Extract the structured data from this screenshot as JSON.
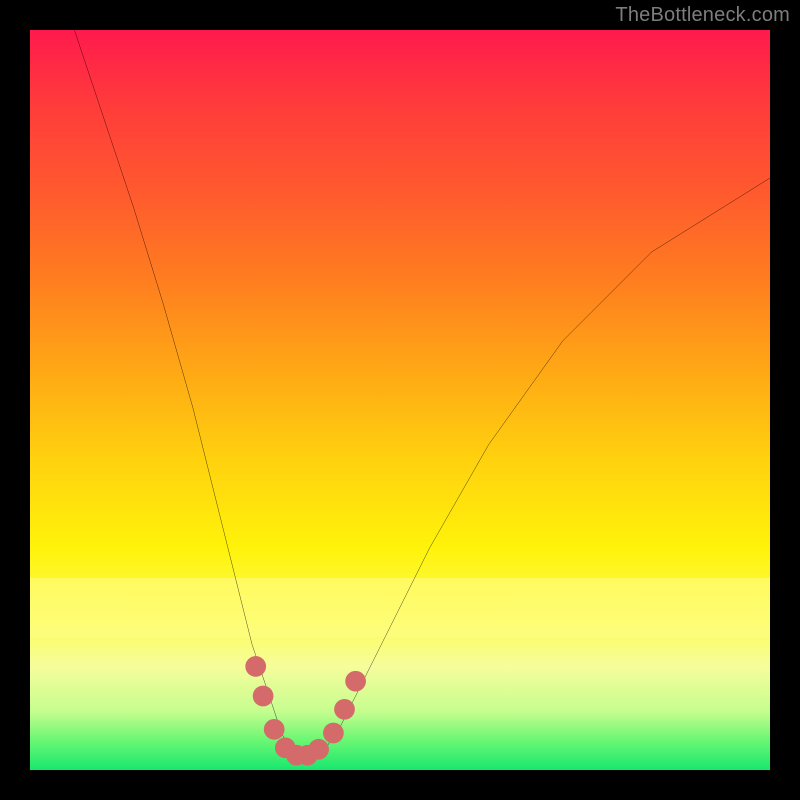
{
  "watermark": "TheBottleneck.com",
  "colors": {
    "curve": "#000000",
    "markers": "#d46a6a",
    "background_frame": "#000000"
  },
  "chart_data": {
    "type": "line",
    "title": "",
    "xlabel": "",
    "ylabel": "",
    "xlim": [
      0,
      100
    ],
    "ylim": [
      0,
      100
    ],
    "grid": false,
    "legend": false,
    "series": [
      {
        "name": "bottleneck-curve",
        "x": [
          6,
          10,
          14,
          18,
          22,
          26,
          28,
          30,
          32,
          33,
          34,
          35,
          36,
          37,
          38,
          39,
          40,
          42,
          44,
          48,
          54,
          62,
          72,
          84,
          100
        ],
        "values": [
          100,
          88,
          76,
          63,
          49,
          33,
          25,
          17,
          11,
          8,
          5,
          3,
          2,
          1.5,
          1.5,
          2,
          3,
          6,
          10,
          18,
          30,
          44,
          58,
          70,
          80
        ]
      }
    ],
    "annotations": {
      "trough_markers_x": [
        30.5,
        31.5,
        33,
        34.5,
        36,
        37.5,
        39,
        41,
        42.5,
        44
      ],
      "trough_markers_y": [
        14,
        10,
        5.5,
        3,
        2,
        2,
        2.8,
        5,
        8.2,
        12
      ],
      "highlight_band_y": [
        18,
        26
      ]
    }
  }
}
